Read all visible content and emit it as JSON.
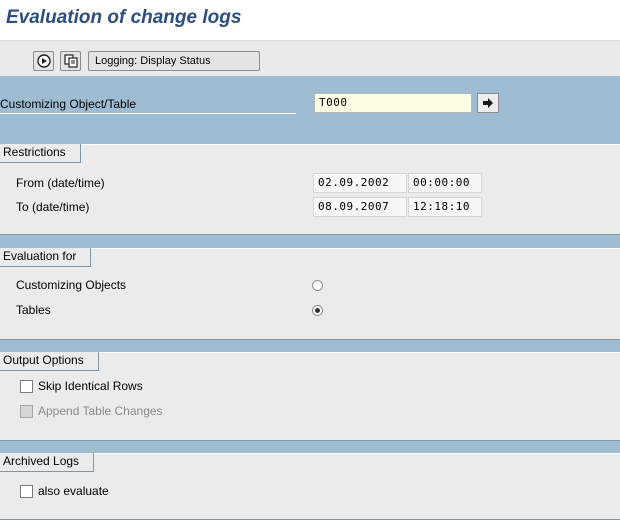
{
  "title": "Evaluation of change logs",
  "toolbar": {
    "execute_icon": "execute-clock-icon",
    "copy_icon": "copy-pages-icon",
    "logging_button_label": "Logging: Display Status"
  },
  "customizing": {
    "label": "Customizing Object/Table",
    "value": "T000",
    "arrow_icon": "right-arrow-icon"
  },
  "restrictions": {
    "tab": "Restrictions",
    "from_label": "From (date/time)",
    "from_date": "02.09.2002",
    "from_time": "00:00:00",
    "to_label": "To (date/time)",
    "to_date": "08.09.2007",
    "to_time": "12:18:10"
  },
  "evaluation": {
    "tab": "Evaluation for",
    "customizing_objects_label": "Customizing Objects",
    "customizing_objects_selected": false,
    "tables_label": "Tables",
    "tables_selected": true
  },
  "output": {
    "tab": "Output Options",
    "skip_identical_label": "Skip Identical Rows",
    "skip_identical_checked": false,
    "append_changes_label": "Append Table Changes",
    "append_changes_checked": false,
    "append_changes_enabled": false
  },
  "archived": {
    "tab": "Archived Logs",
    "also_evaluate_label": "also evaluate",
    "also_evaluate_checked": false
  },
  "colors": {
    "title": "#2c4f80",
    "background": "#9fbdd2",
    "group": "#ebebeb",
    "input": "#fffce6"
  }
}
